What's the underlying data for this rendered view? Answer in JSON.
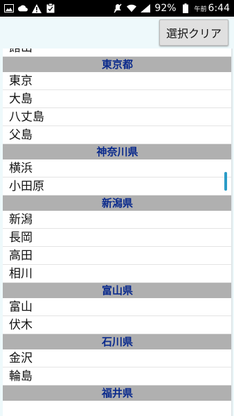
{
  "status_bar": {
    "battery_percent": "92%",
    "time_prefix": "午前",
    "time": "6:44"
  },
  "toolbar": {
    "clear_label": "選択クリア"
  },
  "list": {
    "partial_top_item": "館山",
    "sections": [
      {
        "header": "東京都",
        "items": [
          "東京",
          "大島",
          "八丈島",
          "父島"
        ]
      },
      {
        "header": "神奈川県",
        "items": [
          "横浜",
          "小田原"
        ]
      },
      {
        "header": "新潟県",
        "items": [
          "新潟",
          "長岡",
          "高田",
          "相川"
        ]
      },
      {
        "header": "富山県",
        "items": [
          "富山",
          "伏木"
        ]
      },
      {
        "header": "石川県",
        "items": [
          "金沢",
          "輪島"
        ]
      },
      {
        "header": "福井県",
        "items": []
      }
    ]
  }
}
